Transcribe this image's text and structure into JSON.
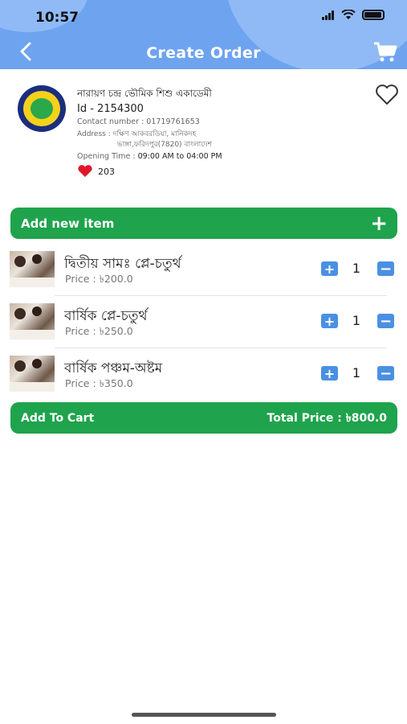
{
  "status_bar": {
    "time": "10:57"
  },
  "header": {
    "title": "Create Order"
  },
  "shop": {
    "name": "নারায়ণ চন্দ্র ভৌমিক শিশু একাডেমী",
    "id": "Id - 2154300",
    "contact": "Contact number : 01719761653",
    "address_label": "Address : ",
    "address_line1": "দক্ষিণ আকবরডিয়া, মানিকদহ",
    "address_line2": "ভাঙ্গা,ফরিদপুর(7820) বাংলাদেশ",
    "opening_label": "Opening Time : ",
    "opening_value": "09:00 AM to 04:00 PM",
    "likes": "203"
  },
  "add_new_item": {
    "label": "Add new item",
    "icon": "+"
  },
  "items": [
    {
      "name": "দ্বিতীয় সামঃ প্লে-চতুর্থ",
      "price": "Price : ৳200.0",
      "qty": "1"
    },
    {
      "name": "বার্ষিক প্লে-চতুর্থ",
      "price": "Price : ৳250.0",
      "qty": "1"
    },
    {
      "name": "বার্ষিক পঞ্চম-অষ্টম",
      "price": "Price : ৳350.0",
      "qty": "1"
    }
  ],
  "buttons": {
    "plus": "+",
    "minus": "−"
  },
  "footer": {
    "add_to_cart": "Add To Cart",
    "total_price": "Total Price : ৳800.0"
  },
  "colors": {
    "header": "#6ea3ef",
    "green": "#1fa34c",
    "stepper": "#4a90e2",
    "heart": "#e0162b"
  }
}
